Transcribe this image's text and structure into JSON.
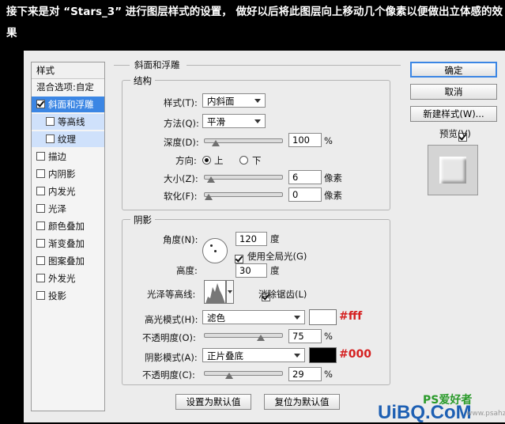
{
  "caption": {
    "text": "接下来是对 “Stars_3” 进行图层样式的设置， 做好以后将此图层向上移动几个像素以便做出立体感的效果"
  },
  "sidebar": {
    "title": "样式",
    "items": [
      {
        "label": "混合选项:自定",
        "checkbox": false,
        "checked": false
      },
      {
        "label": "斜面和浮雕",
        "checkbox": true,
        "checked": true
      },
      {
        "label": "等高线",
        "checkbox": true,
        "checked": false
      },
      {
        "label": "纹理",
        "checkbox": true,
        "checked": false
      },
      {
        "label": "描边",
        "checkbox": true,
        "checked": false
      },
      {
        "label": "内阴影",
        "checkbox": true,
        "checked": false
      },
      {
        "label": "内发光",
        "checkbox": true,
        "checked": false
      },
      {
        "label": "光泽",
        "checkbox": true,
        "checked": false
      },
      {
        "label": "颜色叠加",
        "checkbox": true,
        "checked": false
      },
      {
        "label": "渐变叠加",
        "checkbox": true,
        "checked": false
      },
      {
        "label": "图案叠加",
        "checkbox": true,
        "checked": false
      },
      {
        "label": "外发光",
        "checkbox": true,
        "checked": false
      },
      {
        "label": "投影",
        "checkbox": true,
        "checked": false
      }
    ]
  },
  "bevel": {
    "title": "斜面和浮雕",
    "structure": {
      "title": "结构",
      "style_label": "样式(T):",
      "style_value": "内斜面",
      "technique_label": "方法(Q):",
      "technique_value": "平滑",
      "depth_label": "深度(D):",
      "depth_value": "100",
      "depth_unit": "%",
      "depth_fraction": 0.1,
      "direction_label": "方向:",
      "dir_up": "上",
      "dir_down": "下",
      "direction_selected": "上",
      "size_label": "大小(Z):",
      "size_value": "6",
      "size_unit": "像素",
      "size_fraction": 0.03,
      "soften_label": "软化(F):",
      "soften_value": "0",
      "soften_unit": "像素",
      "soften_fraction": 0.0
    },
    "shading": {
      "title": "阴影",
      "angle_label": "角度(N):",
      "angle_value": "120",
      "angle_unit": "度",
      "global_light_label": "使用全局光(G)",
      "global_light_checked": true,
      "altitude_label": "高度:",
      "altitude_value": "30",
      "altitude_unit": "度",
      "gloss_label": "光泽等高线:",
      "antialias_label": "消除锯齿(L)",
      "antialias_checked": true,
      "highlight_label": "高光模式(H):",
      "highlight_mode": "滤色",
      "highlight_color": "#ffffff",
      "highlight_note": "#fff",
      "hl_opacity_label": "不透明度(O):",
      "hl_opacity_value": "75",
      "hl_opacity_unit": "%",
      "hl_opacity_fraction": 0.75,
      "shadow_label": "阴影模式(A):",
      "shadow_mode": "正片叠底",
      "shadow_color": "#000000",
      "shadow_note": "#000",
      "sh_opacity_label": "不透明度(C):",
      "sh_opacity_value": "29",
      "sh_opacity_unit": "%",
      "sh_opacity_fraction": 0.29
    },
    "btn_default": "设置为默认值",
    "btn_reset": "复位为默认值"
  },
  "actions": {
    "ok": "确定",
    "cancel": "取消",
    "new_style": "新建样式(W)...",
    "preview_label": "预览(V)",
    "preview_checked": true
  },
  "watermark": {
    "brand": "UiBQ.CoM",
    "site": "PS爱好者",
    "url": "www.psahz.com"
  }
}
